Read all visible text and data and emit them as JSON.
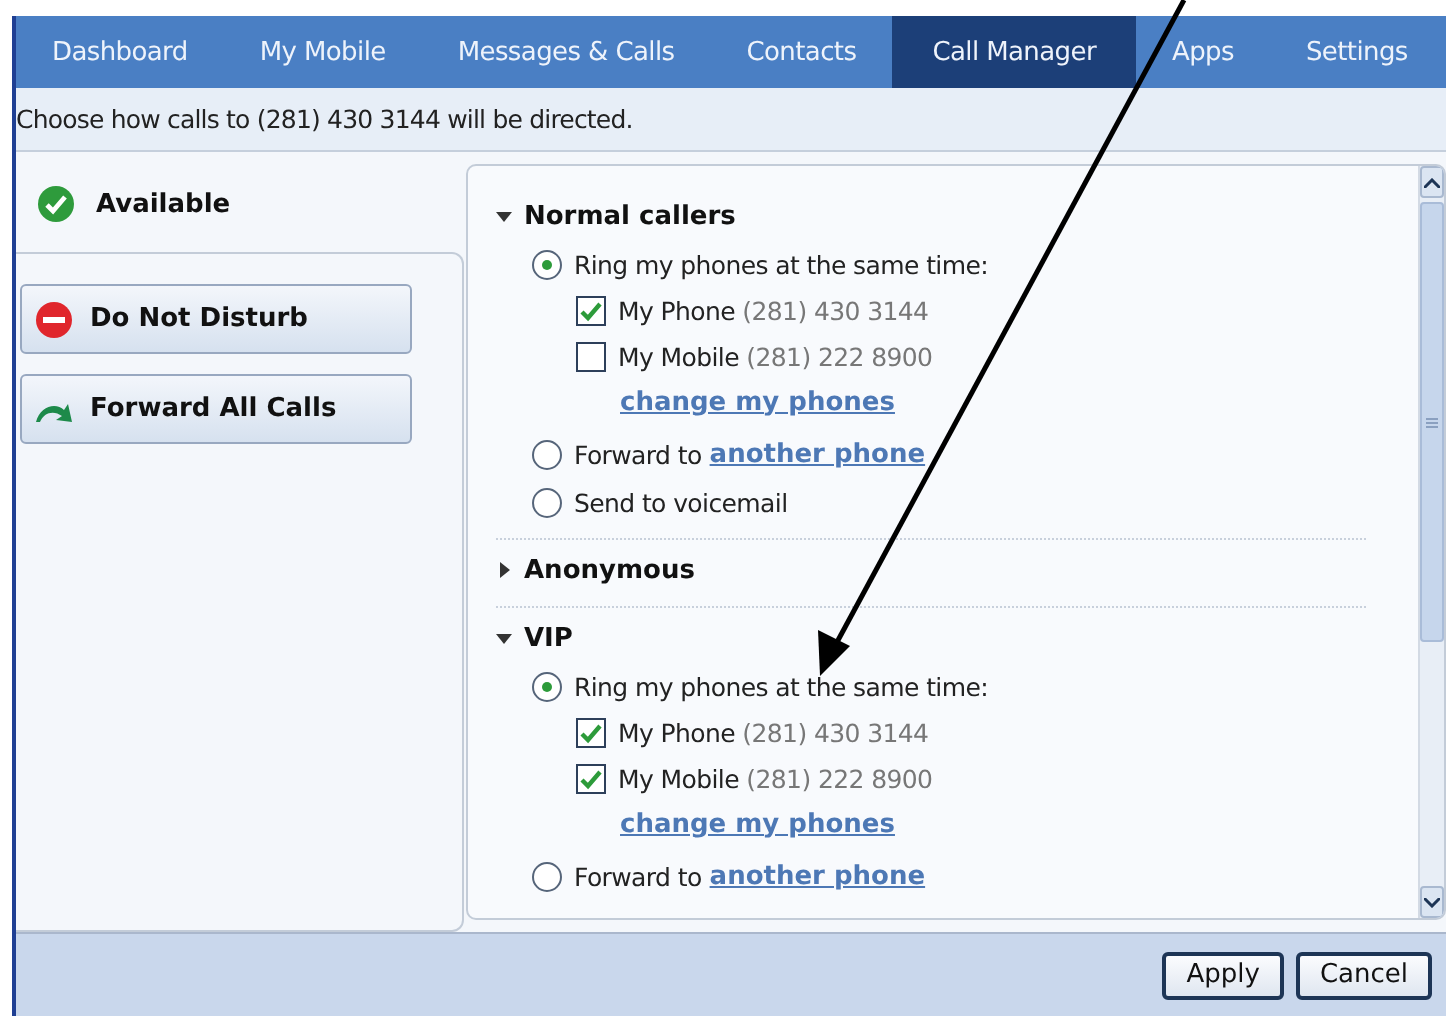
{
  "tabs": [
    {
      "label": "Dashboard",
      "selected": false
    },
    {
      "label": "My Mobile",
      "selected": false
    },
    {
      "label": "Messages & Calls",
      "selected": false
    },
    {
      "label": "Contacts",
      "selected": false
    },
    {
      "label": "Call Manager",
      "selected": true
    },
    {
      "label": "Apps",
      "selected": false
    },
    {
      "label": "Settings",
      "selected": false
    }
  ],
  "instruction": "Choose how calls to (281) 430 3144 will be directed.",
  "statuses": [
    {
      "kind": "current",
      "label": "Available"
    },
    {
      "kind": "dnd",
      "label": "Do Not Disturb"
    },
    {
      "kind": "forward",
      "label": "Forward All Calls"
    }
  ],
  "groups": [
    {
      "title": "Normal callers",
      "expanded": true,
      "options": [
        {
          "kind": "ring",
          "selected": true,
          "label": "Ring my phones at the same time:",
          "phones": [
            {
              "name": "My Phone",
              "number": "(281) 430 3144",
              "checked": true
            },
            {
              "name": "My Mobile",
              "number": "(281) 222 8900",
              "checked": false
            }
          ],
          "link": "change my phones"
        },
        {
          "kind": "forward",
          "selected": false,
          "label": "Forward to",
          "link": "another phone"
        },
        {
          "kind": "voicemail",
          "selected": false,
          "label": "Send to voicemail"
        }
      ]
    },
    {
      "title": "Anonymous",
      "expanded": false
    },
    {
      "title": "VIP",
      "expanded": true,
      "options": [
        {
          "kind": "ring",
          "selected": true,
          "label": "Ring my phones at the same time:",
          "phones": [
            {
              "name": "My Phone",
              "number": "(281) 430 3144",
              "checked": true
            },
            {
              "name": "My Mobile",
              "number": "(281) 222 8900",
              "checked": true
            }
          ],
          "link": "change my phones"
        },
        {
          "kind": "forward",
          "selected": false,
          "label": "Forward to",
          "link": "another phone"
        }
      ]
    }
  ],
  "buttons": [
    "Apply",
    "Cancel"
  ]
}
